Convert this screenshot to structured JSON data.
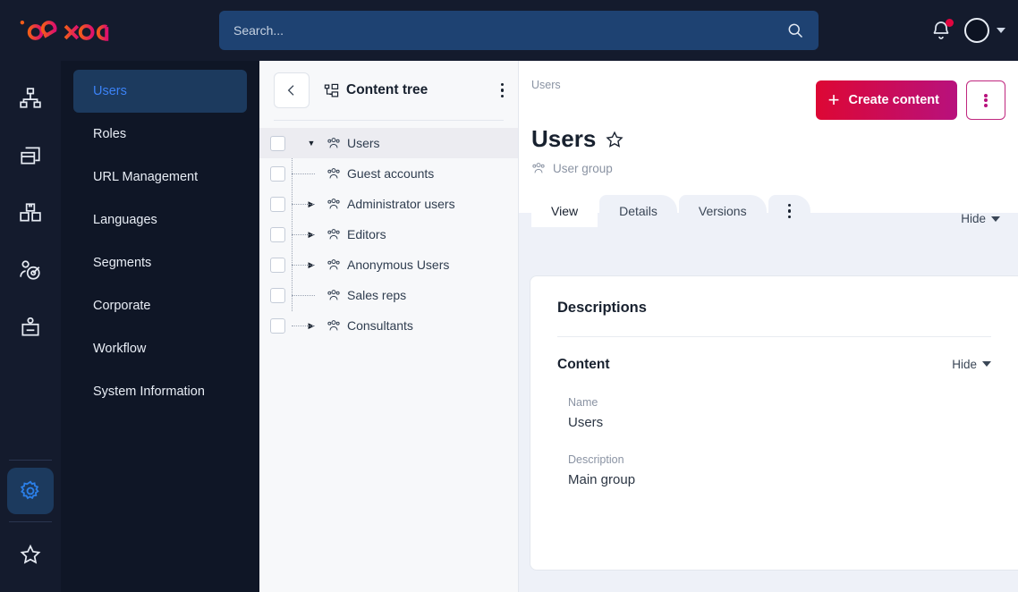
{
  "brand": {
    "name": "ibexa",
    "gradient_from": "#F25C19",
    "gradient_to": "#DE0F6E"
  },
  "topbar": {
    "search_placeholder": "Search...",
    "search_value": "",
    "search_icon": "search-icon",
    "notifications_icon": "bell-icon",
    "avatar_icon": "user-avatar",
    "caret_icon": "chevron-down-icon"
  },
  "rail": {
    "items": [
      {
        "icon": "sitemap-icon",
        "active": false
      },
      {
        "icon": "media-cards-icon",
        "active": false
      },
      {
        "icon": "products-boxes-icon",
        "active": false
      },
      {
        "icon": "customer-target-icon",
        "active": false
      },
      {
        "icon": "id-badge-icon",
        "active": false
      }
    ],
    "bottom": [
      {
        "icon": "gear-icon",
        "active": true
      },
      {
        "icon": "star-icon",
        "active": false
      }
    ]
  },
  "sidebar": {
    "items": [
      {
        "label": "Users",
        "active": true
      },
      {
        "label": "Roles",
        "active": false
      },
      {
        "label": "URL Management",
        "active": false
      },
      {
        "label": "Languages",
        "active": false
      },
      {
        "label": "Segments",
        "active": false
      },
      {
        "label": "Corporate",
        "active": false
      },
      {
        "label": "Workflow",
        "active": false
      },
      {
        "label": "System Information",
        "active": false
      }
    ]
  },
  "tree": {
    "title": "Content tree",
    "title_icon": "content-tree-icon",
    "back_icon": "chevron-left-icon",
    "menu_icon": "kebab-menu-icon",
    "nodes": [
      {
        "label": "Users",
        "depth": 0,
        "toggle": "expanded",
        "selected": true,
        "icon": "user-group-icon"
      },
      {
        "label": "Guest accounts",
        "depth": 1,
        "toggle": "none",
        "selected": false,
        "icon": "user-group-icon"
      },
      {
        "label": "Administrator users",
        "depth": 1,
        "toggle": "collapsed",
        "selected": false,
        "icon": "user-group-icon"
      },
      {
        "label": "Editors",
        "depth": 1,
        "toggle": "collapsed",
        "selected": false,
        "icon": "user-group-icon"
      },
      {
        "label": "Anonymous Users",
        "depth": 1,
        "toggle": "collapsed",
        "selected": false,
        "icon": "user-group-icon"
      },
      {
        "label": "Sales reps",
        "depth": 1,
        "toggle": "none",
        "selected": false,
        "icon": "user-group-icon"
      },
      {
        "label": "Consultants",
        "depth": 1,
        "toggle": "collapsed",
        "selected": false,
        "icon": "user-group-icon"
      }
    ]
  },
  "main": {
    "breadcrumb": "Users",
    "title": "Users",
    "favorite_icon": "star-icon",
    "subtitle": "User group",
    "subtitle_icon": "user-group-icon",
    "create_button": "Create content",
    "create_icon": "plus-icon",
    "more_icon": "kebab-menu-icon",
    "tabs": [
      {
        "label": "View",
        "active": true
      },
      {
        "label": "Details",
        "active": false
      },
      {
        "label": "Versions",
        "active": false
      },
      {
        "label": "",
        "active": false,
        "icon": "kebab-menu-icon"
      }
    ],
    "hide_label": "Hide",
    "panel_heading": "Descriptions",
    "section": {
      "heading": "Content",
      "hide_label": "Hide",
      "fields": [
        {
          "label": "Name",
          "value": "Users"
        },
        {
          "label": "Description",
          "value": "Main group"
        }
      ]
    }
  }
}
